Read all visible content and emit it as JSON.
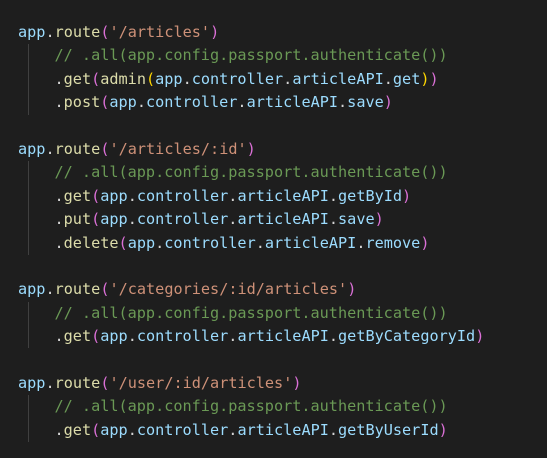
{
  "colors": {
    "background": "#1e1e1e",
    "identifier": "#9cdcfe",
    "function": "#dcdcaa",
    "punctuation": "#d4d4d4",
    "string": "#ce9178",
    "comment": "#6a9955",
    "paren_level1": "#da70d6",
    "paren_level2": "#ffd700",
    "paren_level3": "#179fff"
  },
  "code": {
    "lines": [
      {
        "indent": 0,
        "tokens": [
          {
            "t": "app",
            "c": "ident"
          },
          {
            "t": ".",
            "c": "punct"
          },
          {
            "t": "route",
            "c": "func"
          },
          {
            "t": "(",
            "c": "paren1"
          },
          {
            "t": "'/articles'",
            "c": "str"
          },
          {
            "t": ")",
            "c": "paren1"
          }
        ]
      },
      {
        "indent": 1,
        "tokens": [
          {
            "t": "// .all(app.config.passport.authenticate())",
            "c": "comment"
          }
        ]
      },
      {
        "indent": 1,
        "tokens": [
          {
            "t": ".",
            "c": "punct"
          },
          {
            "t": "get",
            "c": "func"
          },
          {
            "t": "(",
            "c": "paren1"
          },
          {
            "t": "admin",
            "c": "func"
          },
          {
            "t": "(",
            "c": "paren2"
          },
          {
            "t": "app",
            "c": "ident"
          },
          {
            "t": ".",
            "c": "punct"
          },
          {
            "t": "controller",
            "c": "ident"
          },
          {
            "t": ".",
            "c": "punct"
          },
          {
            "t": "articleAPI",
            "c": "ident"
          },
          {
            "t": ".",
            "c": "punct"
          },
          {
            "t": "get",
            "c": "ident"
          },
          {
            "t": ")",
            "c": "paren2"
          },
          {
            "t": ")",
            "c": "paren1"
          }
        ]
      },
      {
        "indent": 1,
        "tokens": [
          {
            "t": ".",
            "c": "punct"
          },
          {
            "t": "post",
            "c": "func"
          },
          {
            "t": "(",
            "c": "paren1"
          },
          {
            "t": "app",
            "c": "ident"
          },
          {
            "t": ".",
            "c": "punct"
          },
          {
            "t": "controller",
            "c": "ident"
          },
          {
            "t": ".",
            "c": "punct"
          },
          {
            "t": "articleAPI",
            "c": "ident"
          },
          {
            "t": ".",
            "c": "punct"
          },
          {
            "t": "save",
            "c": "ident"
          },
          {
            "t": ")",
            "c": "paren1"
          }
        ]
      },
      {
        "indent": 0,
        "tokens": []
      },
      {
        "indent": 0,
        "tokens": [
          {
            "t": "app",
            "c": "ident"
          },
          {
            "t": ".",
            "c": "punct"
          },
          {
            "t": "route",
            "c": "func"
          },
          {
            "t": "(",
            "c": "paren1"
          },
          {
            "t": "'/articles/:id'",
            "c": "str"
          },
          {
            "t": ")",
            "c": "paren1"
          }
        ]
      },
      {
        "indent": 1,
        "tokens": [
          {
            "t": "// .all(app.config.passport.authenticate())",
            "c": "comment"
          }
        ]
      },
      {
        "indent": 1,
        "tokens": [
          {
            "t": ".",
            "c": "punct"
          },
          {
            "t": "get",
            "c": "func"
          },
          {
            "t": "(",
            "c": "paren1"
          },
          {
            "t": "app",
            "c": "ident"
          },
          {
            "t": ".",
            "c": "punct"
          },
          {
            "t": "controller",
            "c": "ident"
          },
          {
            "t": ".",
            "c": "punct"
          },
          {
            "t": "articleAPI",
            "c": "ident"
          },
          {
            "t": ".",
            "c": "punct"
          },
          {
            "t": "getById",
            "c": "ident"
          },
          {
            "t": ")",
            "c": "paren1"
          }
        ]
      },
      {
        "indent": 1,
        "tokens": [
          {
            "t": ".",
            "c": "punct"
          },
          {
            "t": "put",
            "c": "func"
          },
          {
            "t": "(",
            "c": "paren1"
          },
          {
            "t": "app",
            "c": "ident"
          },
          {
            "t": ".",
            "c": "punct"
          },
          {
            "t": "controller",
            "c": "ident"
          },
          {
            "t": ".",
            "c": "punct"
          },
          {
            "t": "articleAPI",
            "c": "ident"
          },
          {
            "t": ".",
            "c": "punct"
          },
          {
            "t": "save",
            "c": "ident"
          },
          {
            "t": ")",
            "c": "paren1"
          }
        ]
      },
      {
        "indent": 1,
        "tokens": [
          {
            "t": ".",
            "c": "punct"
          },
          {
            "t": "delete",
            "c": "func"
          },
          {
            "t": "(",
            "c": "paren1"
          },
          {
            "t": "app",
            "c": "ident"
          },
          {
            "t": ".",
            "c": "punct"
          },
          {
            "t": "controller",
            "c": "ident"
          },
          {
            "t": ".",
            "c": "punct"
          },
          {
            "t": "articleAPI",
            "c": "ident"
          },
          {
            "t": ".",
            "c": "punct"
          },
          {
            "t": "remove",
            "c": "ident"
          },
          {
            "t": ")",
            "c": "paren1"
          }
        ]
      },
      {
        "indent": 0,
        "tokens": []
      },
      {
        "indent": 0,
        "tokens": [
          {
            "t": "app",
            "c": "ident"
          },
          {
            "t": ".",
            "c": "punct"
          },
          {
            "t": "route",
            "c": "func"
          },
          {
            "t": "(",
            "c": "paren1"
          },
          {
            "t": "'/categories/:id/articles'",
            "c": "str"
          },
          {
            "t": ")",
            "c": "paren1"
          }
        ]
      },
      {
        "indent": 1,
        "tokens": [
          {
            "t": "// .all(app.config.passport.authenticate())",
            "c": "comment"
          }
        ]
      },
      {
        "indent": 1,
        "tokens": [
          {
            "t": ".",
            "c": "punct"
          },
          {
            "t": "get",
            "c": "func"
          },
          {
            "t": "(",
            "c": "paren1"
          },
          {
            "t": "app",
            "c": "ident"
          },
          {
            "t": ".",
            "c": "punct"
          },
          {
            "t": "controller",
            "c": "ident"
          },
          {
            "t": ".",
            "c": "punct"
          },
          {
            "t": "articleAPI",
            "c": "ident"
          },
          {
            "t": ".",
            "c": "punct"
          },
          {
            "t": "getByCategoryId",
            "c": "ident"
          },
          {
            "t": ")",
            "c": "paren1"
          }
        ]
      },
      {
        "indent": 0,
        "tokens": []
      },
      {
        "indent": 0,
        "tokens": [
          {
            "t": "app",
            "c": "ident"
          },
          {
            "t": ".",
            "c": "punct"
          },
          {
            "t": "route",
            "c": "func"
          },
          {
            "t": "(",
            "c": "paren1"
          },
          {
            "t": "'/user/:id/articles'",
            "c": "str"
          },
          {
            "t": ")",
            "c": "paren1"
          }
        ]
      },
      {
        "indent": 1,
        "tokens": [
          {
            "t": "// .all(app.config.passport.authenticate())",
            "c": "comment"
          }
        ]
      },
      {
        "indent": 1,
        "tokens": [
          {
            "t": ".",
            "c": "punct"
          },
          {
            "t": "get",
            "c": "func"
          },
          {
            "t": "(",
            "c": "paren1"
          },
          {
            "t": "app",
            "c": "ident"
          },
          {
            "t": ".",
            "c": "punct"
          },
          {
            "t": "controller",
            "c": "ident"
          },
          {
            "t": ".",
            "c": "punct"
          },
          {
            "t": "articleAPI",
            "c": "ident"
          },
          {
            "t": ".",
            "c": "punct"
          },
          {
            "t": "getByUserId",
            "c": "ident"
          },
          {
            "t": ")",
            "c": "paren1"
          }
        ]
      }
    ]
  }
}
